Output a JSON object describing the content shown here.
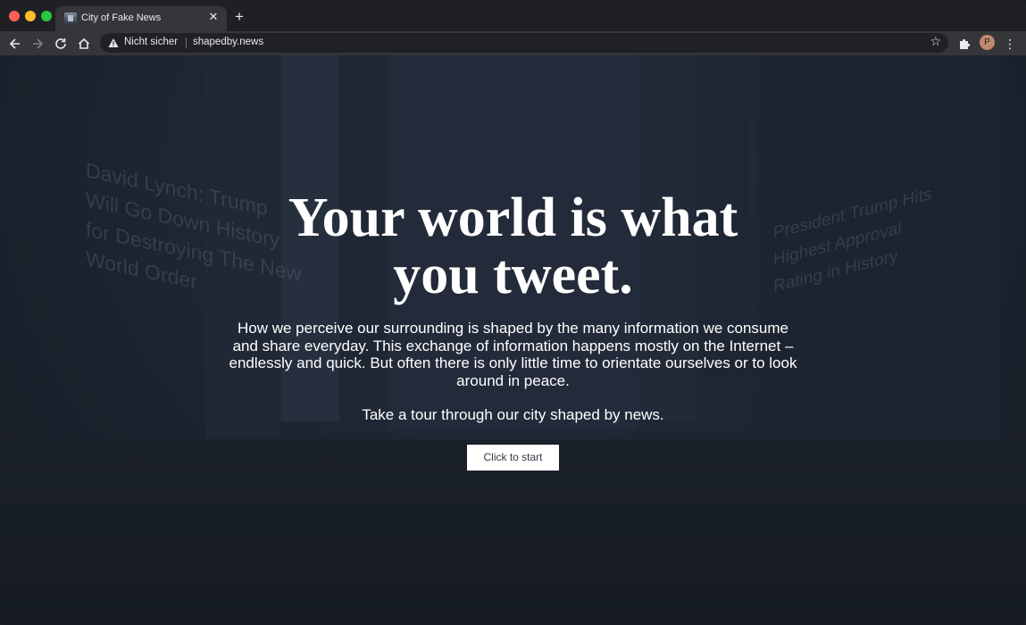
{
  "browser": {
    "tab_title": "City of Fake News",
    "tab_close_icon": "close-icon",
    "new_tab_icon": "plus-icon",
    "security_label": "Nicht sicher",
    "url": "shapedby.news",
    "profile_initial": "P"
  },
  "background": {
    "left_billboard": [
      "David Lynch: Trump",
      "Will Go Down History",
      "for Destroying The New",
      "World Order"
    ],
    "right_billboard": [
      "President Trump Hits",
      "Highest Approval",
      "Rating in History"
    ]
  },
  "hero": {
    "headline": "Your world is what you tweet.",
    "description": "How we perceive our surrounding is shaped by the many information we consume and share everyday. This exchange of information happens mostly on the Internet – endlessly and quick. But often there is only little time to orientate ourselves or to look around in peace.",
    "tour_text": "Take a tour through our city shaped by news.",
    "start_button": "Click to start"
  },
  "colors": {
    "page_bg": "#1e2531",
    "button_bg": "#ffffff",
    "text": "#ffffff"
  }
}
